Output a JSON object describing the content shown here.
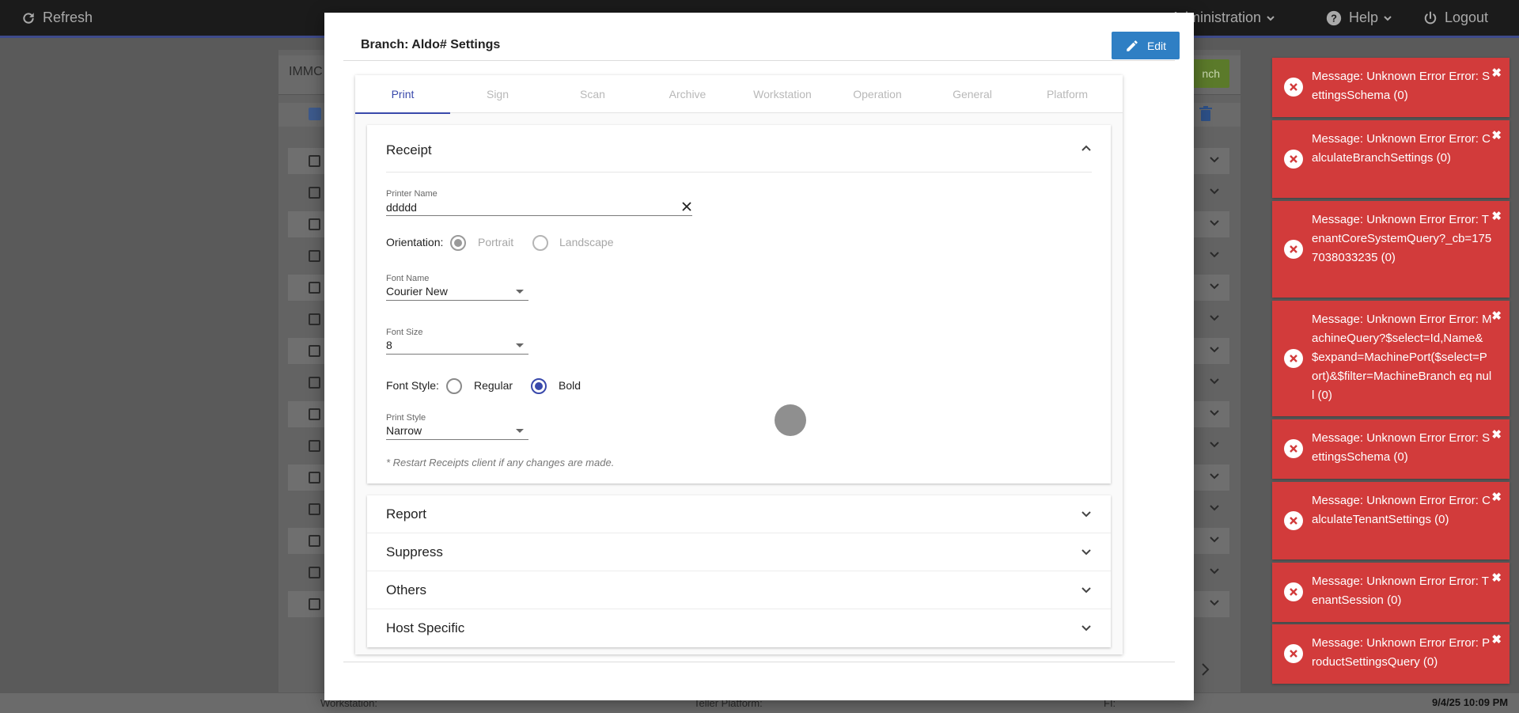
{
  "topbar": {
    "refresh_label": "Refresh",
    "administration_label": "Administration",
    "help_label": "Help",
    "logout_label": "Logout"
  },
  "background": {
    "search_text": "IMMC",
    "search_button_label": "nch",
    "footer": {
      "workstation_label": "Workstation:",
      "teller_platform_label": "Teller Platform:",
      "fi_label": "FI:",
      "datetime": "9/4/25 10:09 PM"
    }
  },
  "modal": {
    "title": "Branch: Aldo# Settings",
    "edit_label": "Edit",
    "tabs": [
      {
        "label": "Print",
        "active": true
      },
      {
        "label": "Sign"
      },
      {
        "label": "Scan"
      },
      {
        "label": "Archive"
      },
      {
        "label": "Workstation"
      },
      {
        "label": "Operation"
      },
      {
        "label": "General"
      },
      {
        "label": "Platform"
      }
    ],
    "receipt": {
      "title": "Receipt",
      "printer_name_label": "Printer Name",
      "printer_name_value": "ddddd",
      "orientation_label": "Orientation:",
      "orientation_options": [
        "Portrait",
        "Landscape"
      ],
      "orientation_selected": "Portrait",
      "font_name_label": "Font Name",
      "font_name_value": "Courier New",
      "font_size_label": "Font Size",
      "font_size_value": "8",
      "font_style_label": "Font Style:",
      "font_style_options": [
        "Regular",
        "Bold"
      ],
      "font_style_selected": "Bold",
      "print_style_label": "Print Style",
      "print_style_value": "Narrow",
      "note": "* Restart Receipts client if any changes are made."
    },
    "collapsed_panels": [
      "Report",
      "Suppress",
      "Others",
      "Host Specific"
    ]
  },
  "toasts": [
    {
      "text": "Message: Unknown Error Error: SettingsSchema (0)"
    },
    {
      "text": "Message: Unknown Error Error: CalculateBranchSettings (0)"
    },
    {
      "text": "Message: Unknown Error Error: TenantCoreSystemQuery?_cb=1757038033235 (0)"
    },
    {
      "text": "Message: Unknown Error Error: MachineQuery?$select=Id,Name&$expand=MachinePort($select=Port)&$filter=MachineBranch eq null (0)"
    },
    {
      "text": "Message: Unknown Error Error: SettingsSchema (0)"
    },
    {
      "text": "Message: Unknown Error Error: CalculateTenantSettings (0)"
    },
    {
      "text": "Message: Unknown Error Error: TenantSession (0)"
    },
    {
      "text": "Message: Unknown Error Error: ProductSettingsQuery (0)"
    }
  ],
  "colors": {
    "toast_bg": "#d23b3b",
    "edit_button": "#2f7fc4",
    "tab_active": "#3949ab"
  }
}
